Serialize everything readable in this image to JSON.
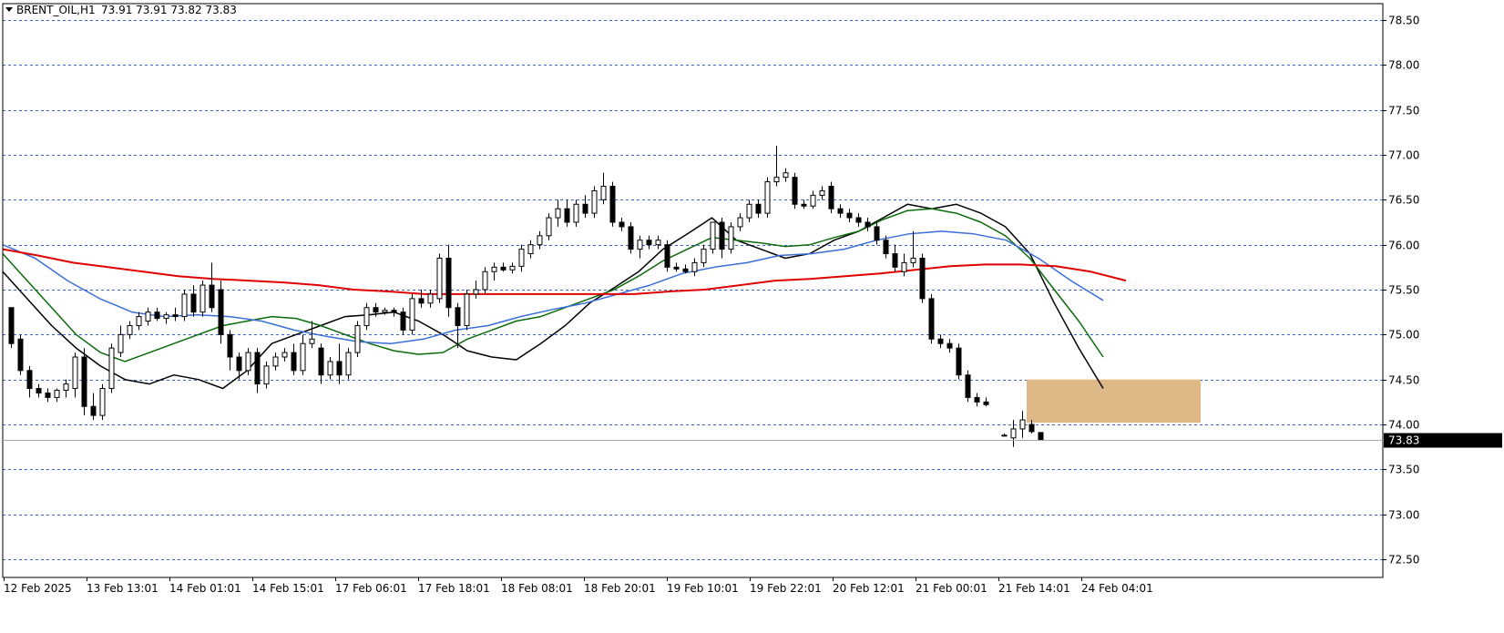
{
  "header": {
    "symbol": "BRENT_OIL,H1",
    "ohlc": "73.91 73.91 73.82 73.83"
  },
  "colors": {
    "background": "#ffffff",
    "grid": "#3a63c9",
    "candle": "#000000",
    "ma_fast": "#000000",
    "ma_mid": "#0b6b0b",
    "ma_slow": "#3a6fd8",
    "ma_long": "#e00000",
    "zone": "#deb887",
    "current_price_label_bg": "#000000",
    "current_price_label_fg": "#ffffff"
  },
  "chart_data": {
    "type": "candlestick",
    "ylim": [
      72.5,
      78.5
    ],
    "y_ticks": [
      "72.50",
      "73.00",
      "73.50",
      "74.00",
      "74.50",
      "75.00",
      "75.50",
      "76.00",
      "76.50",
      "77.00",
      "77.50",
      "78.00",
      "78.50"
    ],
    "x_ticks": [
      "12 Feb 2025",
      "13 Feb 13:01",
      "14 Feb 01:01",
      "14 Feb 15:01",
      "17 Feb 06:01",
      "17 Feb 18:01",
      "18 Feb 08:01",
      "18 Feb 20:01",
      "19 Feb 10:01",
      "19 Feb 22:01",
      "20 Feb 12:01",
      "21 Feb 00:01",
      "21 Feb 14:01",
      "24 Feb 04:01"
    ],
    "grid": true,
    "current_price": "73.83",
    "candles": [
      {
        "o": 75.3,
        "h": 75.3,
        "l": 74.85,
        "c": 74.9
      },
      {
        "o": 74.95,
        "h": 75.0,
        "l": 74.55,
        "c": 74.6
      },
      {
        "o": 74.6,
        "h": 74.65,
        "l": 74.3,
        "c": 74.4
      },
      {
        "o": 74.4,
        "h": 74.45,
        "l": 74.3,
        "c": 74.35
      },
      {
        "o": 74.35,
        "h": 74.4,
        "l": 74.25,
        "c": 74.3
      },
      {
        "o": 74.3,
        "h": 74.4,
        "l": 74.25,
        "c": 74.38
      },
      {
        "o": 74.38,
        "h": 74.5,
        "l": 74.3,
        "c": 74.45
      },
      {
        "o": 74.4,
        "h": 74.8,
        "l": 74.3,
        "c": 74.75
      },
      {
        "o": 74.75,
        "h": 74.85,
        "l": 74.1,
        "c": 74.2
      },
      {
        "o": 74.2,
        "h": 74.35,
        "l": 74.05,
        "c": 74.1
      },
      {
        "o": 74.1,
        "h": 74.45,
        "l": 74.05,
        "c": 74.4
      },
      {
        "o": 74.4,
        "h": 74.9,
        "l": 74.35,
        "c": 74.85
      },
      {
        "o": 74.8,
        "h": 75.1,
        "l": 74.75,
        "c": 75.0
      },
      {
        "o": 75.0,
        "h": 75.15,
        "l": 74.95,
        "c": 75.1
      },
      {
        "o": 75.1,
        "h": 75.25,
        "l": 75.05,
        "c": 75.2
      },
      {
        "o": 75.15,
        "h": 75.3,
        "l": 75.1,
        "c": 75.25
      },
      {
        "o": 75.25,
        "h": 75.3,
        "l": 75.15,
        "c": 75.18
      },
      {
        "o": 75.18,
        "h": 75.25,
        "l": 75.12,
        "c": 75.22
      },
      {
        "o": 75.22,
        "h": 75.3,
        "l": 75.15,
        "c": 75.2
      },
      {
        "o": 75.2,
        "h": 75.5,
        "l": 75.15,
        "c": 75.45
      },
      {
        "o": 75.45,
        "h": 75.55,
        "l": 75.2,
        "c": 75.25
      },
      {
        "o": 75.25,
        "h": 75.6,
        "l": 75.2,
        "c": 75.55
      },
      {
        "o": 75.55,
        "h": 75.8,
        "l": 75.25,
        "c": 75.3
      },
      {
        "o": 75.5,
        "h": 75.6,
        "l": 74.9,
        "c": 75.0
      },
      {
        "o": 75.0,
        "h": 75.05,
        "l": 74.6,
        "c": 74.75
      },
      {
        "o": 74.75,
        "h": 74.8,
        "l": 74.5,
        "c": 74.6
      },
      {
        "o": 74.6,
        "h": 74.85,
        "l": 74.55,
        "c": 74.8
      },
      {
        "o": 74.8,
        "h": 74.85,
        "l": 74.35,
        "c": 74.45
      },
      {
        "o": 74.45,
        "h": 74.7,
        "l": 74.4,
        "c": 74.65
      },
      {
        "o": 74.65,
        "h": 74.8,
        "l": 74.6,
        "c": 74.75
      },
      {
        "o": 74.75,
        "h": 74.85,
        "l": 74.7,
        "c": 74.8
      },
      {
        "o": 74.8,
        "h": 74.9,
        "l": 74.55,
        "c": 74.6
      },
      {
        "o": 74.6,
        "h": 75.0,
        "l": 74.55,
        "c": 74.9
      },
      {
        "o": 74.9,
        "h": 75.15,
        "l": 74.85,
        "c": 74.95
      },
      {
        "o": 74.85,
        "h": 74.9,
        "l": 74.45,
        "c": 74.55
      },
      {
        "o": 74.55,
        "h": 74.75,
        "l": 74.5,
        "c": 74.7
      },
      {
        "o": 74.7,
        "h": 74.9,
        "l": 74.45,
        "c": 74.55
      },
      {
        "o": 74.55,
        "h": 74.85,
        "l": 74.5,
        "c": 74.8
      },
      {
        "o": 74.8,
        "h": 75.15,
        "l": 74.75,
        "c": 75.1
      },
      {
        "o": 75.1,
        "h": 75.35,
        "l": 75.05,
        "c": 75.3
      },
      {
        "o": 75.3,
        "h": 75.35,
        "l": 75.2,
        "c": 75.25
      },
      {
        "o": 75.25,
        "h": 75.3,
        "l": 75.22,
        "c": 75.27
      },
      {
        "o": 75.27,
        "h": 75.3,
        "l": 75.2,
        "c": 75.25
      },
      {
        "o": 75.25,
        "h": 75.3,
        "l": 75.0,
        "c": 75.05
      },
      {
        "o": 75.05,
        "h": 75.45,
        "l": 75.0,
        "c": 75.4
      },
      {
        "o": 75.4,
        "h": 75.5,
        "l": 75.3,
        "c": 75.35
      },
      {
        "o": 75.35,
        "h": 75.5,
        "l": 75.3,
        "c": 75.45
      },
      {
        "o": 75.4,
        "h": 75.9,
        "l": 75.35,
        "c": 75.85
      },
      {
        "o": 75.85,
        "h": 76.0,
        "l": 75.2,
        "c": 75.3
      },
      {
        "o": 75.3,
        "h": 75.35,
        "l": 74.85,
        "c": 75.1
      },
      {
        "o": 75.1,
        "h": 75.5,
        "l": 75.05,
        "c": 75.45
      },
      {
        "o": 75.45,
        "h": 75.6,
        "l": 75.4,
        "c": 75.5
      },
      {
        "o": 75.5,
        "h": 75.75,
        "l": 75.45,
        "c": 75.7
      },
      {
        "o": 75.7,
        "h": 75.8,
        "l": 75.6,
        "c": 75.75
      },
      {
        "o": 75.75,
        "h": 75.8,
        "l": 75.7,
        "c": 75.72
      },
      {
        "o": 75.72,
        "h": 75.8,
        "l": 75.68,
        "c": 75.76
      },
      {
        "o": 75.76,
        "h": 76.0,
        "l": 75.7,
        "c": 75.95
      },
      {
        "o": 75.9,
        "h": 76.05,
        "l": 75.85,
        "c": 76.0
      },
      {
        "o": 76.0,
        "h": 76.15,
        "l": 75.95,
        "c": 76.1
      },
      {
        "o": 76.1,
        "h": 76.35,
        "l": 76.05,
        "c": 76.3
      },
      {
        "o": 76.3,
        "h": 76.5,
        "l": 76.2,
        "c": 76.4
      },
      {
        "o": 76.4,
        "h": 76.5,
        "l": 76.2,
        "c": 76.25
      },
      {
        "o": 76.25,
        "h": 76.5,
        "l": 76.2,
        "c": 76.45
      },
      {
        "o": 76.45,
        "h": 76.55,
        "l": 76.3,
        "c": 76.35
      },
      {
        "o": 76.35,
        "h": 76.65,
        "l": 76.3,
        "c": 76.6
      },
      {
        "o": 76.5,
        "h": 76.8,
        "l": 76.45,
        "c": 76.65
      },
      {
        "o": 76.65,
        "h": 76.7,
        "l": 76.2,
        "c": 76.25
      },
      {
        "o": 76.25,
        "h": 76.3,
        "l": 76.15,
        "c": 76.2
      },
      {
        "o": 76.2,
        "h": 76.25,
        "l": 75.9,
        "c": 75.95
      },
      {
        "o": 75.95,
        "h": 76.1,
        "l": 75.85,
        "c": 76.05
      },
      {
        "o": 76.05,
        "h": 76.1,
        "l": 75.95,
        "c": 76.0
      },
      {
        "o": 76.0,
        "h": 76.1,
        "l": 75.95,
        "c": 76.05
      },
      {
        "o": 76.0,
        "h": 76.05,
        "l": 75.7,
        "c": 75.75
      },
      {
        "o": 75.75,
        "h": 75.8,
        "l": 75.7,
        "c": 75.73
      },
      {
        "o": 75.73,
        "h": 75.78,
        "l": 75.68,
        "c": 75.7
      },
      {
        "o": 75.7,
        "h": 75.85,
        "l": 75.65,
        "c": 75.8
      },
      {
        "o": 75.8,
        "h": 76.0,
        "l": 75.75,
        "c": 75.95
      },
      {
        "o": 75.95,
        "h": 76.25,
        "l": 75.9,
        "c": 76.25
      },
      {
        "o": 76.25,
        "h": 76.3,
        "l": 75.85,
        "c": 75.95
      },
      {
        "o": 75.95,
        "h": 76.25,
        "l": 75.9,
        "c": 76.2
      },
      {
        "o": 76.2,
        "h": 76.35,
        "l": 76.15,
        "c": 76.3
      },
      {
        "o": 76.3,
        "h": 76.5,
        "l": 76.25,
        "c": 76.45
      },
      {
        "o": 76.45,
        "h": 76.5,
        "l": 76.3,
        "c": 76.35
      },
      {
        "o": 76.35,
        "h": 76.75,
        "l": 76.3,
        "c": 76.7
      },
      {
        "o": 76.7,
        "h": 77.1,
        "l": 76.65,
        "c": 76.75
      },
      {
        "o": 76.75,
        "h": 76.85,
        "l": 76.7,
        "c": 76.8
      },
      {
        "o": 76.75,
        "h": 76.8,
        "l": 76.4,
        "c": 76.45
      },
      {
        "o": 76.45,
        "h": 76.5,
        "l": 76.4,
        "c": 76.43
      },
      {
        "o": 76.43,
        "h": 76.6,
        "l": 76.4,
        "c": 76.55
      },
      {
        "o": 76.55,
        "h": 76.65,
        "l": 76.5,
        "c": 76.6
      },
      {
        "o": 76.65,
        "h": 76.7,
        "l": 76.35,
        "c": 76.4
      },
      {
        "o": 76.4,
        "h": 76.45,
        "l": 76.3,
        "c": 76.35
      },
      {
        "o": 76.35,
        "h": 76.4,
        "l": 76.25,
        "c": 76.3
      },
      {
        "o": 76.3,
        "h": 76.35,
        "l": 76.2,
        "c": 76.25
      },
      {
        "o": 76.25,
        "h": 76.3,
        "l": 76.15,
        "c": 76.2
      },
      {
        "o": 76.2,
        "h": 76.25,
        "l": 76.0,
        "c": 76.05
      },
      {
        "o": 76.05,
        "h": 76.1,
        "l": 75.85,
        "c": 75.9
      },
      {
        "o": 75.9,
        "h": 76.0,
        "l": 75.7,
        "c": 75.75
      },
      {
        "o": 75.7,
        "h": 75.9,
        "l": 75.65,
        "c": 75.8
      },
      {
        "o": 75.8,
        "h": 76.15,
        "l": 75.75,
        "c": 75.85
      },
      {
        "o": 75.85,
        "h": 75.9,
        "l": 75.35,
        "c": 75.4
      },
      {
        "o": 75.4,
        "h": 75.45,
        "l": 74.9,
        "c": 74.95
      },
      {
        "o": 74.95,
        "h": 75.0,
        "l": 74.85,
        "c": 74.9
      },
      {
        "o": 74.9,
        "h": 74.95,
        "l": 74.8,
        "c": 74.85
      },
      {
        "o": 74.85,
        "h": 74.9,
        "l": 74.5,
        "c": 74.55
      },
      {
        "o": 74.55,
        "h": 74.6,
        "l": 74.25,
        "c": 74.3
      },
      {
        "o": 74.3,
        "h": 74.35,
        "l": 74.2,
        "c": 74.25
      },
      {
        "o": 74.25,
        "h": 74.3,
        "l": 74.2,
        "c": 74.22
      },
      null,
      {
        "o": 73.88,
        "h": 73.9,
        "l": 73.87,
        "c": 73.88
      },
      {
        "o": 73.85,
        "h": 74.05,
        "l": 73.75,
        "c": 73.95
      },
      {
        "o": 73.95,
        "h": 74.15,
        "l": 73.85,
        "c": 74.05
      },
      {
        "o": 74.0,
        "h": 74.05,
        "l": 73.9,
        "c": 73.92
      },
      {
        "o": 73.91,
        "h": 73.91,
        "l": 73.82,
        "c": 73.83
      }
    ],
    "moving_averages": [
      {
        "color": "#000000",
        "values": [
          75.7,
          75.4,
          75.1,
          74.85,
          74.65,
          74.5,
          74.45,
          74.55,
          74.5,
          74.4,
          74.6,
          74.9,
          75.0,
          75.1,
          75.2,
          75.22,
          75.25,
          75.15,
          75.0,
          74.82,
          74.75,
          74.72,
          74.9,
          75.1,
          75.35,
          75.52,
          75.7,
          75.95,
          76.12,
          76.3,
          76.05,
          75.95,
          75.85,
          75.9,
          76.05,
          76.15,
          76.3,
          76.45,
          76.4,
          76.45,
          76.35,
          76.2,
          75.9,
          75.35,
          74.85,
          74.4
        ]
      },
      {
        "color": "#0b6b0b",
        "values": [
          75.9,
          75.6,
          75.3,
          75.0,
          74.8,
          74.7,
          74.8,
          74.9,
          75.0,
          75.1,
          75.15,
          75.2,
          75.18,
          75.1,
          75.0,
          74.9,
          74.82,
          74.78,
          74.8,
          74.95,
          75.05,
          75.15,
          75.2,
          75.3,
          75.4,
          75.5,
          75.65,
          75.82,
          75.95,
          76.08,
          76.05,
          76.02,
          75.98,
          76.0,
          76.08,
          76.15,
          76.28,
          76.38,
          76.4,
          76.35,
          76.25,
          76.1,
          75.85,
          75.5,
          75.15,
          74.75
        ]
      },
      {
        "color": "#3a6fd8",
        "values": [
          76.0,
          75.85,
          75.6,
          75.4,
          75.25,
          75.2,
          75.22,
          75.2,
          75.15,
          75.05,
          74.98,
          74.92,
          74.9,
          74.95,
          75.05,
          75.1,
          75.2,
          75.28,
          75.35,
          75.45,
          75.55,
          75.68,
          75.75,
          75.8,
          75.88,
          75.9,
          75.95,
          76.05,
          76.12,
          76.15,
          76.12,
          76.05,
          75.85,
          75.6,
          75.38
        ]
      },
      {
        "color": "#e00000",
        "values": [
          75.95,
          75.88,
          75.8,
          75.75,
          75.7,
          75.65,
          75.62,
          75.6,
          75.58,
          75.55,
          75.5,
          75.48,
          75.45,
          75.45,
          75.45,
          75.45,
          75.45,
          75.45,
          75.45,
          75.48,
          75.5,
          75.55,
          75.6,
          75.62,
          75.65,
          75.68,
          75.72,
          75.76,
          75.78,
          75.78,
          75.76,
          75.7,
          75.6
        ]
      }
    ],
    "zone": {
      "y_low": 74.02,
      "y_high": 74.5
    }
  }
}
